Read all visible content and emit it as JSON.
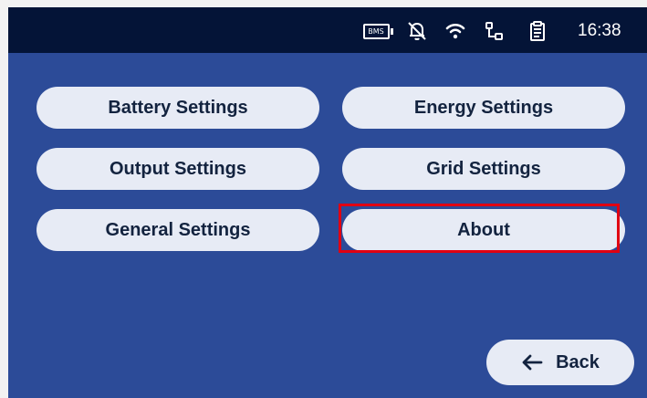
{
  "status_bar": {
    "bms_label": "BMS",
    "time": "16:38",
    "icons": [
      "bms-battery-icon",
      "bell-off-icon",
      "wifi-icon",
      "network-tree-icon",
      "clipboard-icon"
    ]
  },
  "settings": {
    "items": [
      {
        "label": "Battery Settings"
      },
      {
        "label": "Energy Settings"
      },
      {
        "label": "Output Settings"
      },
      {
        "label": "Grid Settings"
      },
      {
        "label": "General Settings"
      },
      {
        "label": "About"
      }
    ],
    "selected_item": "About"
  },
  "footer": {
    "back_label": "Back",
    "back_icon": "left-arrow-icon"
  },
  "colors": {
    "background": "#2c4b98",
    "status_bar": "#041437",
    "button_fill": "#e7ebf5",
    "button_text": "#13233f",
    "selection_outline": "#e00012"
  }
}
